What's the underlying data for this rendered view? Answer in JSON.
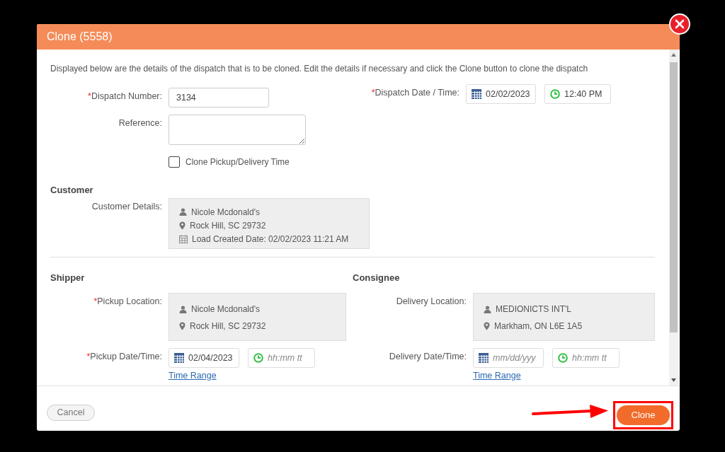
{
  "dialog": {
    "title": "Clone (5558)"
  },
  "intro": "Displayed below are the details of the dispatch that is to be cloned. Edit the details if necessary and click the Clone button to clone the dispatch",
  "dispatch_number": {
    "mark": "*",
    "label": "Dispatch Number:",
    "value": "3134"
  },
  "dispatch_date_time": {
    "mark": "*",
    "label": "Dispatch Date / Time:",
    "date": {
      "value": "02/02/2023"
    },
    "time": {
      "value": "12:40 PM"
    }
  },
  "reference": {
    "label": "Reference:"
  },
  "clone_times": {
    "label": "Clone Pickup/Delivery Time",
    "checked": false
  },
  "customer": {
    "heading": "Customer",
    "label": "Customer Details:",
    "lines": [
      {
        "kind": "person",
        "text": "Nicole Mcdonald's"
      },
      {
        "kind": "location",
        "text": "Rock Hill, SC 29732"
      },
      {
        "kind": "calendar",
        "text": "Load Created Date: 02/02/2023 11:21 AM"
      }
    ]
  },
  "parties": [
    {
      "heading": "Shipper",
      "location": {
        "mark": "*",
        "label": "Pickup Location:",
        "lines": [
          {
            "kind": "person",
            "text": "Nicole Mcdonald's"
          },
          {
            "kind": "location",
            "text": "Rock Hill, SC 29732"
          }
        ]
      },
      "date_time": {
        "mark": "*",
        "label": "Pickup Date/Time:",
        "date": {
          "value": "02/04/2023"
        },
        "time": {
          "placeholder": "hh:mm tt"
        }
      },
      "link": "Time Range"
    },
    {
      "heading": "Consignee",
      "location": {
        "label": "Delivery Location:",
        "lines": [
          {
            "kind": "person",
            "text": "MEDIONICTS INT'L"
          },
          {
            "kind": "location",
            "text": "Markham, ON L6E 1A5"
          }
        ]
      },
      "date_time": {
        "label": "Delivery Date/Time:",
        "date": {
          "placeholder": "mm/dd/yyy"
        },
        "time": {
          "placeholder": "hh:mm tt"
        }
      },
      "link": "Time Range"
    }
  ],
  "footer": {
    "cancel": "Cancel",
    "clone": "Clone"
  }
}
